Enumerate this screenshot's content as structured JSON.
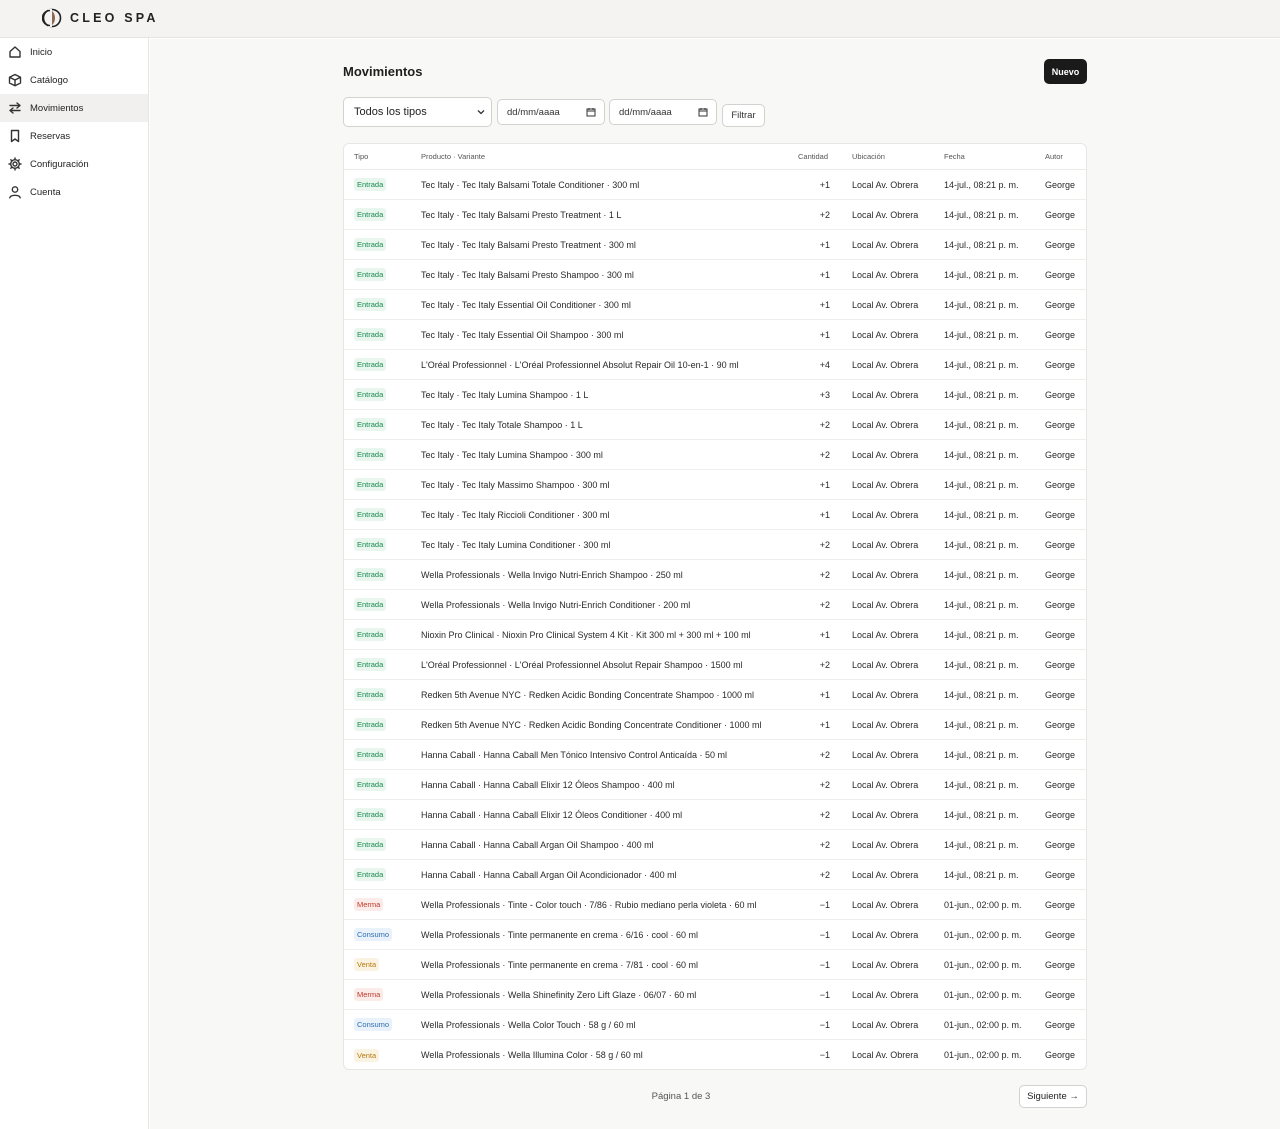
{
  "brand": {
    "name": "CLEO SPA"
  },
  "sidebar": {
    "items": [
      {
        "label": "Inicio",
        "icon": "home-icon",
        "active": false
      },
      {
        "label": "Catálogo",
        "icon": "box-icon",
        "active": false
      },
      {
        "label": "Movimientos",
        "icon": "arrows-icon",
        "active": true
      },
      {
        "label": "Reservas",
        "icon": "bookmark-icon",
        "active": false
      },
      {
        "label": "Configuración",
        "icon": "gear-icon",
        "active": false
      },
      {
        "label": "Cuenta",
        "icon": "user-icon",
        "active": false
      }
    ]
  },
  "main": {
    "title": "Movimientos",
    "new_button": "Nuevo",
    "filters": {
      "type_select": "Todos los tipos",
      "date_from_placeholder": "dd/mm/aaaa",
      "date_to_placeholder": "dd/mm/aaaa",
      "filter_button": "Filtrar"
    },
    "table": {
      "headers": [
        "Tipo",
        "Producto · Variante",
        "Cantidad",
        "Ubicación",
        "Fecha",
        "Autor"
      ],
      "rows": [
        [
          "Entrada",
          "Tec Italy · Tec Italy Balsami Totale Conditioner · 300 ml",
          "+1",
          "Local Av. Obrera",
          "14-jul., 08:21 p. m.",
          "George"
        ],
        [
          "Entrada",
          "Tec Italy · Tec Italy Balsami Presto Treatment · 1 L",
          "+2",
          "Local Av. Obrera",
          "14-jul., 08:21 p. m.",
          "George"
        ],
        [
          "Entrada",
          "Tec Italy · Tec Italy Balsami Presto Treatment · 300 ml",
          "+1",
          "Local Av. Obrera",
          "14-jul., 08:21 p. m.",
          "George"
        ],
        [
          "Entrada",
          "Tec Italy · Tec Italy Balsami Presto Shampoo · 300 ml",
          "+1",
          "Local Av. Obrera",
          "14-jul., 08:21 p. m.",
          "George"
        ],
        [
          "Entrada",
          "Tec Italy · Tec Italy Essential Oil Conditioner · 300 ml",
          "+1",
          "Local Av. Obrera",
          "14-jul., 08:21 p. m.",
          "George"
        ],
        [
          "Entrada",
          "Tec Italy · Tec Italy Essential Oil Shampoo · 300 ml",
          "+1",
          "Local Av. Obrera",
          "14-jul., 08:21 p. m.",
          "George"
        ],
        [
          "Entrada",
          "L'Oréal Professionnel · L'Oréal Professionnel Absolut Repair Oil 10-en-1 · 90 ml",
          "+4",
          "Local Av. Obrera",
          "14-jul., 08:21 p. m.",
          "George"
        ],
        [
          "Entrada",
          "Tec Italy · Tec Italy Lumina Shampoo · 1 L",
          "+3",
          "Local Av. Obrera",
          "14-jul., 08:21 p. m.",
          "George"
        ],
        [
          "Entrada",
          "Tec Italy · Tec Italy Totale Shampoo · 1 L",
          "+2",
          "Local Av. Obrera",
          "14-jul., 08:21 p. m.",
          "George"
        ],
        [
          "Entrada",
          "Tec Italy · Tec Italy Lumina Shampoo · 300 ml",
          "+2",
          "Local Av. Obrera",
          "14-jul., 08:21 p. m.",
          "George"
        ],
        [
          "Entrada",
          "Tec Italy · Tec Italy Massimo Shampoo · 300 ml",
          "+1",
          "Local Av. Obrera",
          "14-jul., 08:21 p. m.",
          "George"
        ],
        [
          "Entrada",
          "Tec Italy · Tec Italy Riccioli Conditioner · 300 ml",
          "+1",
          "Local Av. Obrera",
          "14-jul., 08:21 p. m.",
          "George"
        ],
        [
          "Entrada",
          "Tec Italy · Tec Italy Lumina Conditioner · 300 ml",
          "+2",
          "Local Av. Obrera",
          "14-jul., 08:21 p. m.",
          "George"
        ],
        [
          "Entrada",
          "Wella Professionals · Wella Invigo Nutri-Enrich Shampoo · 250 ml",
          "+2",
          "Local Av. Obrera",
          "14-jul., 08:21 p. m.",
          "George"
        ],
        [
          "Entrada",
          "Wella Professionals · Wella Invigo Nutri-Enrich Conditioner · 200 ml",
          "+2",
          "Local Av. Obrera",
          "14-jul., 08:21 p. m.",
          "George"
        ],
        [
          "Entrada",
          "Nioxin Pro Clinical · Nioxin Pro Clinical System 4 Kit · Kit 300 ml + 300 ml + 100 ml",
          "+1",
          "Local Av. Obrera",
          "14-jul., 08:21 p. m.",
          "George"
        ],
        [
          "Entrada",
          "L'Oréal Professionnel · L'Oréal Professionnel Absolut Repair Shampoo · 1500 ml",
          "+2",
          "Local Av. Obrera",
          "14-jul., 08:21 p. m.",
          "George"
        ],
        [
          "Entrada",
          "Redken 5th Avenue NYC · Redken Acidic Bonding Concentrate Shampoo · 1000 ml",
          "+1",
          "Local Av. Obrera",
          "14-jul., 08:21 p. m.",
          "George"
        ],
        [
          "Entrada",
          "Redken 5th Avenue NYC · Redken Acidic Bonding Concentrate Conditioner · 1000 ml",
          "+1",
          "Local Av. Obrera",
          "14-jul., 08:21 p. m.",
          "George"
        ],
        [
          "Entrada",
          "Hanna Caball · Hanna Caball Men Tónico Intensivo Control Anticaída · 50 ml",
          "+2",
          "Local Av. Obrera",
          "14-jul., 08:21 p. m.",
          "George"
        ],
        [
          "Entrada",
          "Hanna Caball · Hanna Caball Elixir 12 Óleos Shampoo · 400 ml",
          "+2",
          "Local Av. Obrera",
          "14-jul., 08:21 p. m.",
          "George"
        ],
        [
          "Entrada",
          "Hanna Caball · Hanna Caball Elixir 12 Óleos Conditioner · 400 ml",
          "+2",
          "Local Av. Obrera",
          "14-jul., 08:21 p. m.",
          "George"
        ],
        [
          "Entrada",
          "Hanna Caball · Hanna Caball Argan Oil Shampoo · 400 ml",
          "+2",
          "Local Av. Obrera",
          "14-jul., 08:21 p. m.",
          "George"
        ],
        [
          "Entrada",
          "Hanna Caball · Hanna Caball Argan Oil Acondicionador · 400 ml",
          "+2",
          "Local Av. Obrera",
          "14-jul., 08:21 p. m.",
          "George"
        ],
        [
          "Merma",
          "Wella Professionals · Tinte - Color touch · 7/86 · Rubio mediano perla violeta · 60 ml",
          "−1",
          "Local Av. Obrera",
          "01-jun., 02:00 p. m.",
          "George"
        ],
        [
          "Consumo",
          "Wella Professionals · Tinte permanente en crema · 6/16 · cool · 60 ml",
          "−1",
          "Local Av. Obrera",
          "01-jun., 02:00 p. m.",
          "George"
        ],
        [
          "Venta",
          "Wella Professionals · Tinte permanente en crema · 7/81 · cool · 60 ml",
          "−1",
          "Local Av. Obrera",
          "01-jun., 02:00 p. m.",
          "George"
        ],
        [
          "Merma",
          "Wella Professionals · Wella Shinefinity Zero Lift Glaze · 06/07 · 60 ml",
          "−1",
          "Local Av. Obrera",
          "01-jun., 02:00 p. m.",
          "George"
        ],
        [
          "Consumo",
          "Wella Professionals · Wella Color Touch · 58 g / 60 ml",
          "−1",
          "Local Av. Obrera",
          "01-jun., 02:00 p. m.",
          "George"
        ],
        [
          "Venta",
          "Wella Professionals · Wella Illumina Color · 58 g / 60 ml",
          "−1",
          "Local Av. Obrera",
          "01-jun., 02:00 p. m.",
          "George"
        ]
      ]
    },
    "pagination": {
      "text": "Página 1 de 3",
      "next_button": "Siguiente →"
    }
  },
  "colors": {
    "accent": "#1a1a1a",
    "entrada": "#178a4f",
    "merma": "#c0392b",
    "consumo": "#2e6fb0",
    "venta": "#b5790f"
  }
}
